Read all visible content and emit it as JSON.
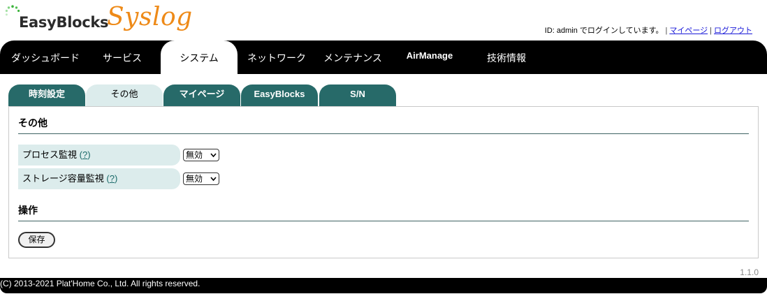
{
  "header": {
    "logo_text": "EasyBlocks",
    "logo_accent": "Syslog",
    "login_status": "ID: admin でログインしています。",
    "mypage_link": "マイページ",
    "logout_link": "ログアウト"
  },
  "main_nav": {
    "items": [
      {
        "label": "ダッシュボード",
        "active": false
      },
      {
        "label": "サービス",
        "active": false
      },
      {
        "label": "システム",
        "active": true
      },
      {
        "label": "ネットワーク",
        "active": false
      },
      {
        "label": "メンテナンス",
        "active": false
      },
      {
        "label": "AirManage",
        "active": false
      },
      {
        "label": "技術情報",
        "active": false
      }
    ]
  },
  "sub_tabs": {
    "items": [
      {
        "label": "時刻設定",
        "active": false
      },
      {
        "label": "その他",
        "active": true
      },
      {
        "label": "マイページ",
        "active": false
      },
      {
        "label": "EasyBlocks",
        "active": false
      },
      {
        "label": "S/N",
        "active": false
      }
    ]
  },
  "panel": {
    "section_title": "その他",
    "settings": [
      {
        "label": "プロセス監視",
        "help": "?",
        "value": "無効"
      },
      {
        "label": "ストレージ容量監視",
        "help": "?",
        "value": "無効"
      }
    ],
    "operations_title": "操作",
    "save_label": "保存"
  },
  "version": "1.1.0",
  "footer": {
    "copyright": "(C) 2013-2021 Plat'Home Co., Ltd. All rights reserved."
  },
  "colors": {
    "nav_bg": "#000000",
    "tab_bg": "#276a69",
    "tab_active_bg": "#dcecec",
    "label_bg": "#dcecec",
    "accent_orange": "#ee8a18",
    "link_blue": "#1a1ad8"
  },
  "icons": {
    "logo_mark": "dotted-circle-icon",
    "select_arrow": "chevron-down-icon"
  }
}
